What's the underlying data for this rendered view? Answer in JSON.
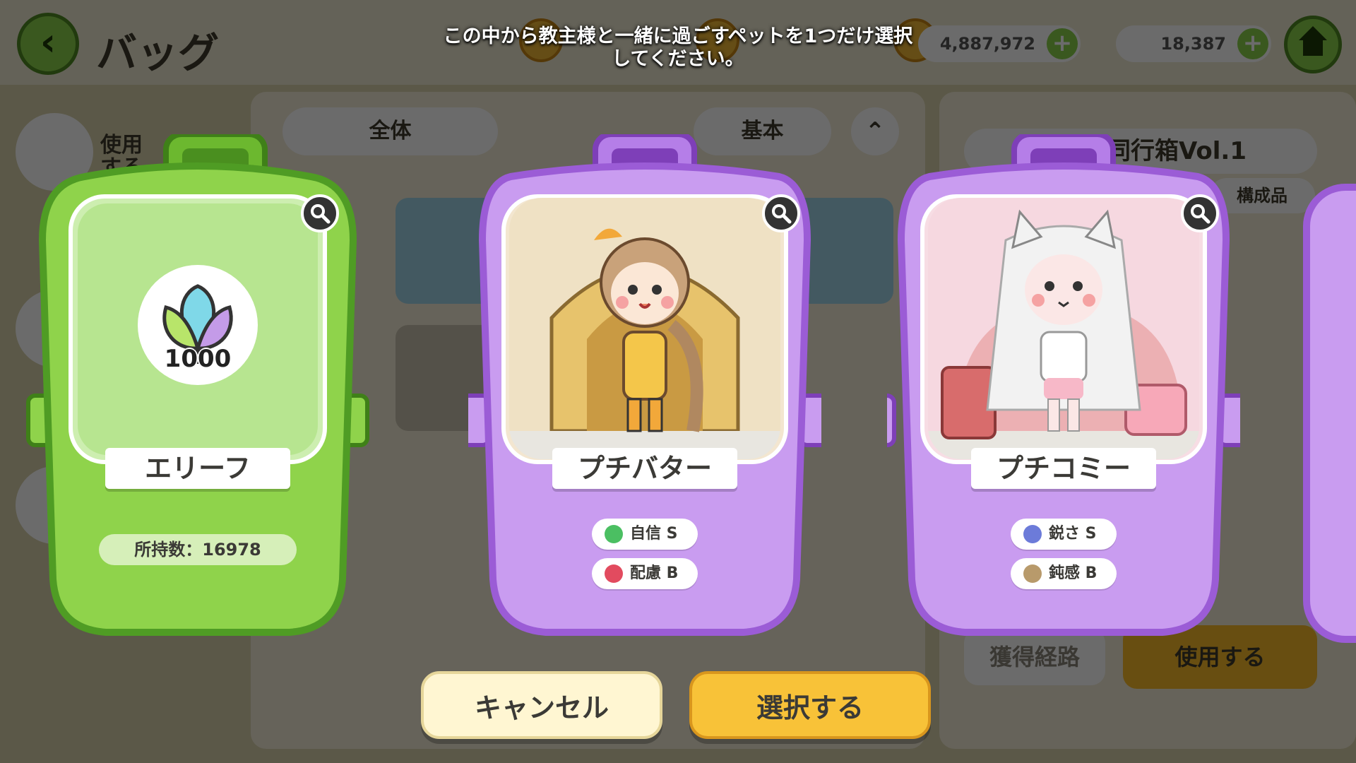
{
  "background": {
    "screen_title": "バッグ",
    "currency1": "4,887,972",
    "currency2": "18,387",
    "side_label": "使用\nする",
    "filter_all": "全体",
    "filter_basic": "基本",
    "item_header": "同行箱Vol.1",
    "components": "構成品",
    "get_route": "獲得経路",
    "use": "使用する"
  },
  "instruction": "この中から教主様と一緒に過ごすペットを1つだけ選択\nしてください。",
  "cards": [
    {
      "name": "エリーフ",
      "owned_label": "所持数：16978",
      "item_amount": "1000",
      "theme": "green"
    },
    {
      "name": "プチバター",
      "theme": "purple",
      "traits": [
        {
          "label": "自信 S",
          "icon": "clover-icon",
          "color": "#4bbf62"
        },
        {
          "label": "配慮 B",
          "icon": "heart-icon",
          "color": "#e24b5f"
        }
      ]
    },
    {
      "name": "プチコミー",
      "theme": "purple",
      "traits": [
        {
          "label": "鋭さ S",
          "icon": "sparkle-icon",
          "color": "#6c7bd9"
        },
        {
          "label": "鈍感 B",
          "icon": "shell-icon",
          "color": "#b89a6b"
        }
      ]
    }
  ],
  "buttons": {
    "cancel": "キャンセル",
    "select": "選択する"
  },
  "colors": {
    "green_body": "#8fd34b",
    "green_rim": "#4f9c24",
    "purple_body": "#c99cf0",
    "purple_rim": "#9b5cd6",
    "select_button": "#f8c238",
    "cancel_button": "#fff6d2"
  }
}
